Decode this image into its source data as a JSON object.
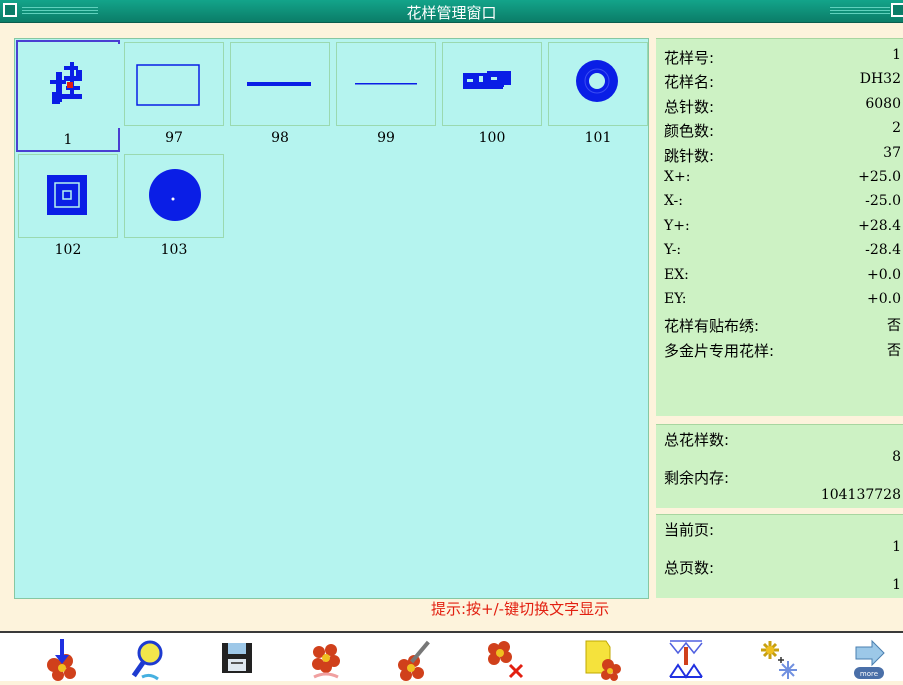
{
  "window": {
    "title": "花样管理窗口"
  },
  "patterns": [
    {
      "label": "1",
      "thumb": "kanji-pattern-icon",
      "selected": true
    },
    {
      "label": "97",
      "thumb": "rectangle-outline-icon"
    },
    {
      "label": "98",
      "thumb": "thick-line-icon"
    },
    {
      "label": "99",
      "thumb": "thin-line-icon"
    },
    {
      "label": "100",
      "thumb": "text-block-icon"
    },
    {
      "label": "101",
      "thumb": "ring-icon"
    },
    {
      "label": "102",
      "thumb": "nested-squares-icon"
    },
    {
      "label": "103",
      "thumb": "filled-circle-icon"
    }
  ],
  "details": {
    "rows": [
      {
        "k": "花样号:",
        "v": "1"
      },
      {
        "k": "花样名:",
        "v": "DH32"
      },
      {
        "k": "总针数:",
        "v": "6080"
      },
      {
        "k": "颜色数:",
        "v": "2"
      },
      {
        "k": "跳针数:",
        "v": "37"
      },
      {
        "k": "X+:",
        "v": "+25.0"
      },
      {
        "k": "X-:",
        "v": "-25.0"
      },
      {
        "k": "Y+:",
        "v": "+28.4"
      },
      {
        "k": "Y-:",
        "v": "-28.4"
      },
      {
        "k": "EX:",
        "v": "+0.0"
      },
      {
        "k": "EY:",
        "v": "+0.0"
      },
      {
        "k": "花样有贴布绣:",
        "v": "否"
      },
      {
        "k": "多金片专用花样:",
        "v": "否"
      }
    ]
  },
  "memory": {
    "total_label": "总花样数:",
    "total": "8",
    "free_label": "剩余内存:",
    "free": "104137728"
  },
  "paging": {
    "current_label": "当前页:",
    "current": "1",
    "total_label": "总页数:",
    "total": "1"
  },
  "hint": "提示:按+/-键切换文字显示",
  "toolbar": [
    {
      "icon": "flower-needle-download-icon"
    },
    {
      "icon": "magnifier-icon"
    },
    {
      "icon": "floppy-disk-icon"
    },
    {
      "icon": "flower-copy-icon"
    },
    {
      "icon": "flower-edit-icon"
    },
    {
      "icon": "flower-delete-icon"
    },
    {
      "icon": "folder-flower-icon"
    },
    {
      "icon": "needle-stitch-icon"
    },
    {
      "icon": "sparkle-add-icon"
    },
    {
      "icon": "more-arrow-icon"
    }
  ],
  "colors": {
    "titlebar": "#0b7d68",
    "panel": "#b5f4ef",
    "info": "#cdf2c4",
    "hint": "#e21f10",
    "stitch": "#0a1ee6"
  }
}
